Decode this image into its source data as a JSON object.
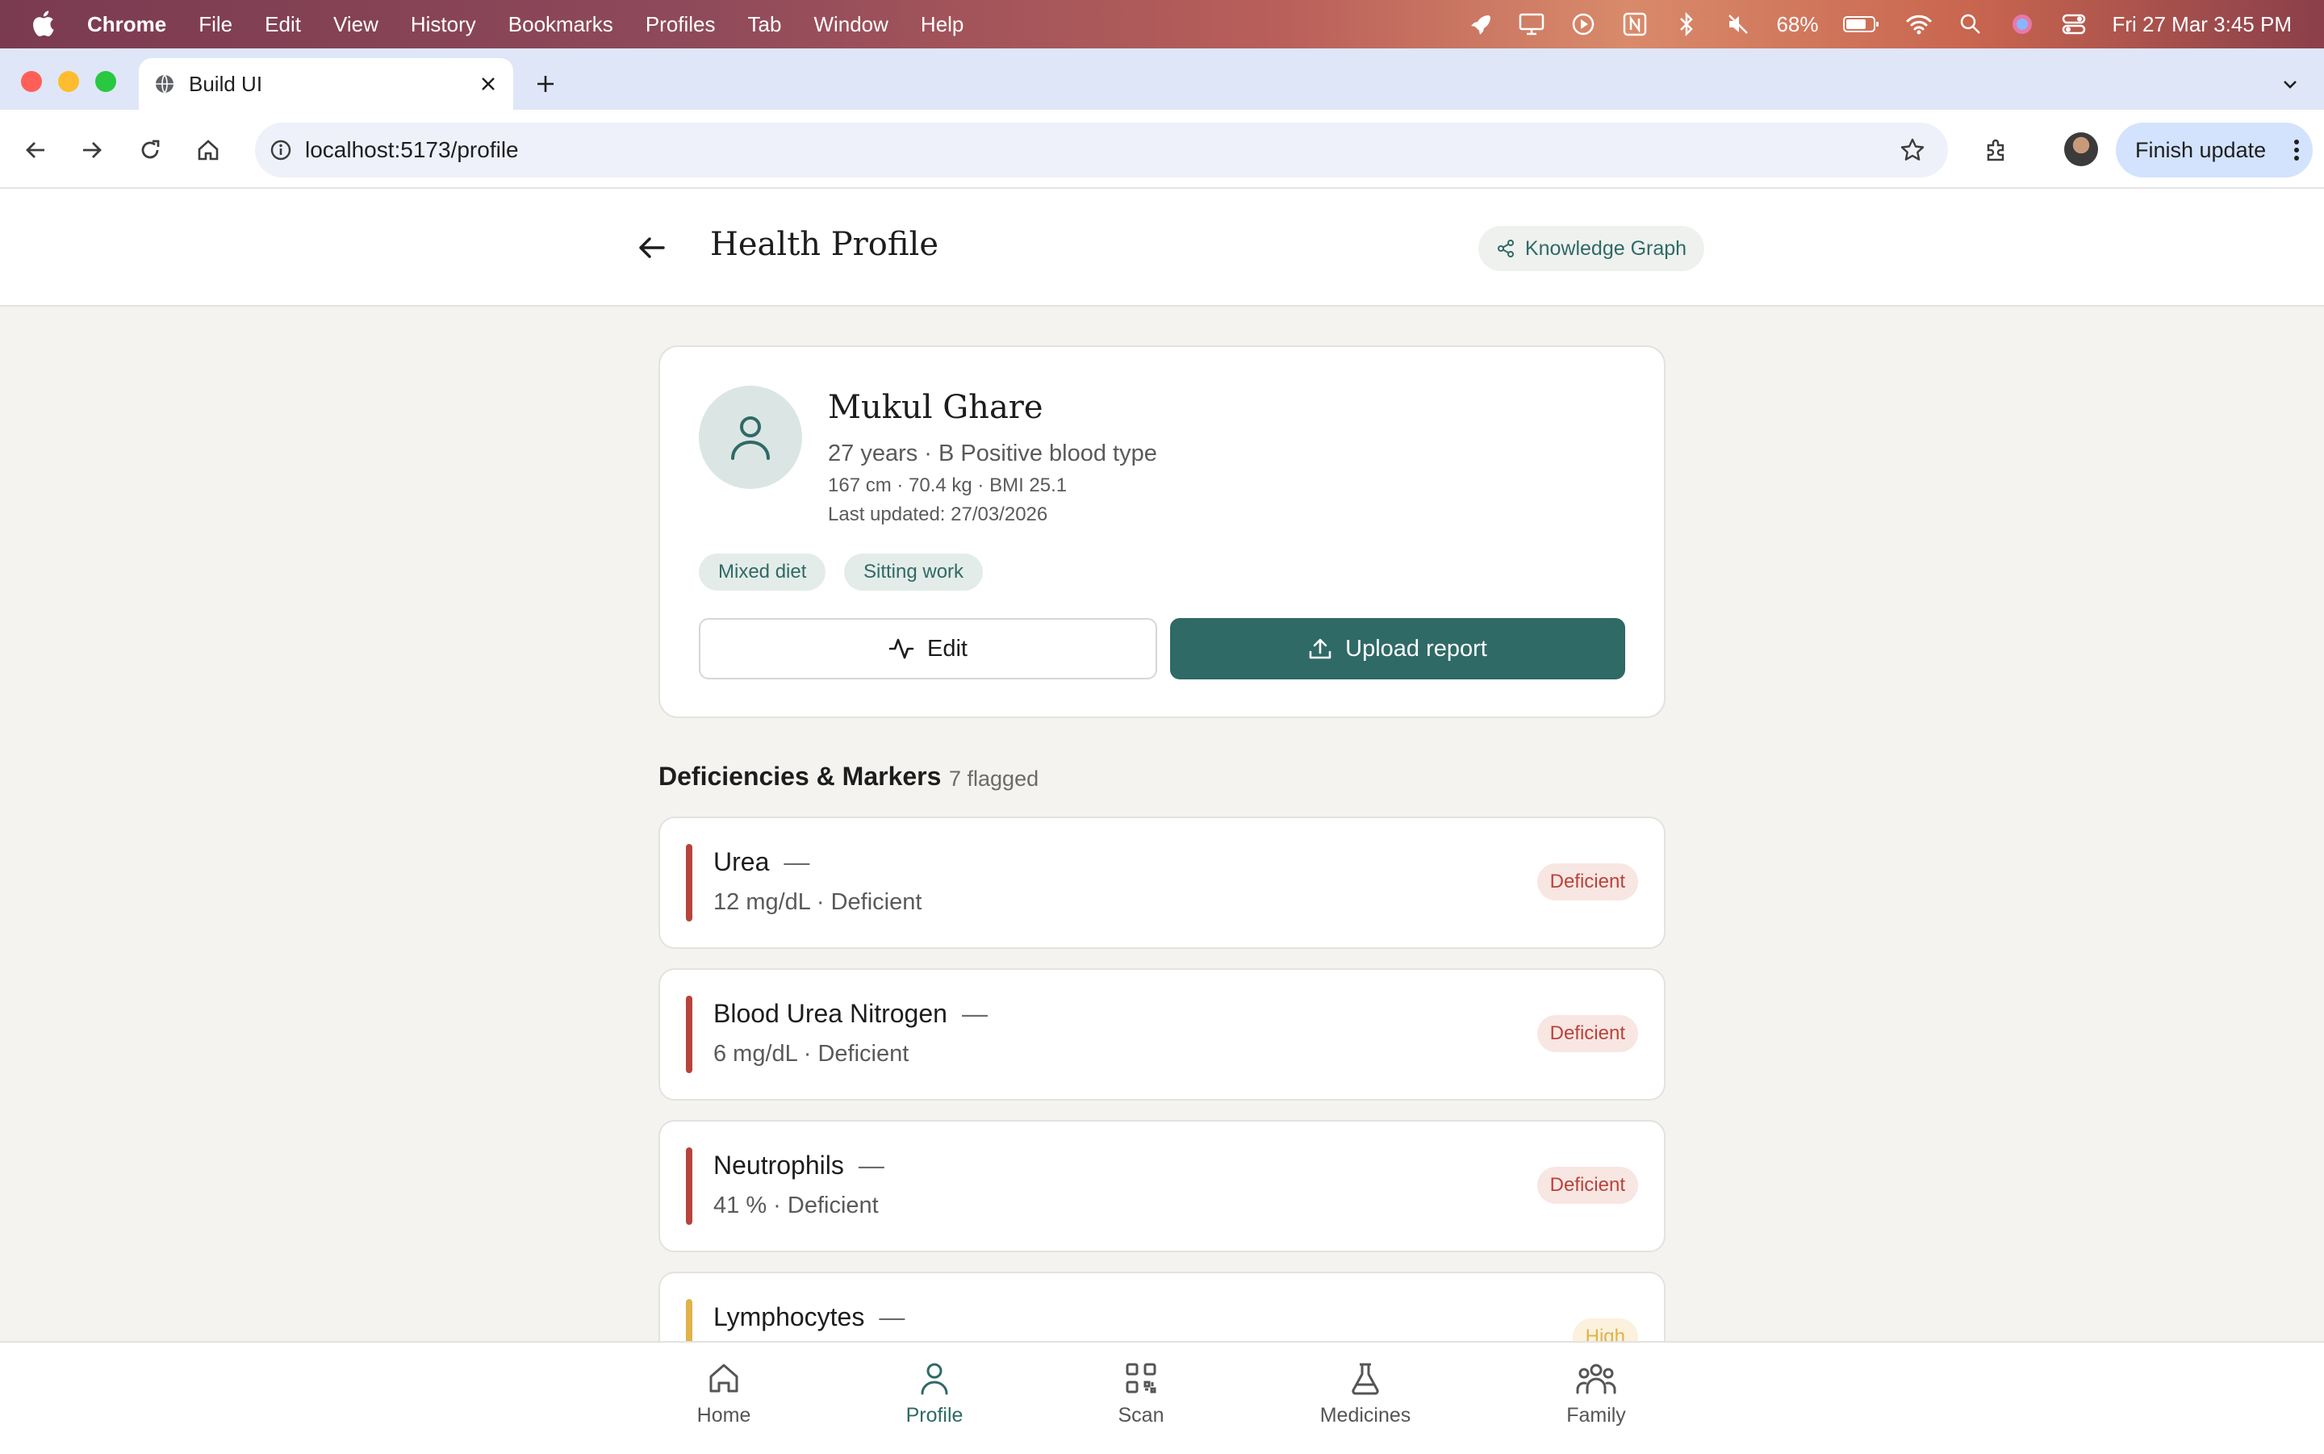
{
  "menubar": {
    "app": "Chrome",
    "items": [
      "File",
      "Edit",
      "View",
      "History",
      "Bookmarks",
      "Profiles",
      "Tab",
      "Window",
      "Help"
    ],
    "battery": "68%",
    "datetime": "Fri 27 Mar  3:45 PM"
  },
  "browser": {
    "tab_title": "Build UI",
    "url": "localhost:5173/profile",
    "finish_update": "Finish update"
  },
  "header": {
    "title": "Health Profile",
    "knowledge_graph": "Knowledge Graph"
  },
  "profile": {
    "name": "Mukul Ghare",
    "line1": "27 years · B Positive blood type",
    "line2": "167 cm · 70.4 kg · BMI 25.1",
    "line3": "Last updated: 27/03/2026",
    "tags": [
      "Mixed diet",
      "Sitting work"
    ],
    "edit_label": "Edit",
    "upload_label": "Upload report"
  },
  "section": {
    "title": "Deficiencies & Markers",
    "count": "7 flagged"
  },
  "markers": [
    {
      "name": "Urea",
      "trend": "—",
      "detail": "12 mg/dL · Deficient",
      "status": "Deficient"
    },
    {
      "name": "Blood Urea Nitrogen",
      "trend": "—",
      "detail": "6 mg/dL · Deficient",
      "status": "Deficient"
    },
    {
      "name": "Neutrophils",
      "trend": "—",
      "detail": "41 % · Deficient",
      "status": "Deficient"
    },
    {
      "name": "Lymphocytes",
      "trend": "—",
      "detail": "",
      "status": "High"
    }
  ],
  "bottom_nav": [
    {
      "label": "Home",
      "icon": "home-icon"
    },
    {
      "label": "Profile",
      "icon": "user-icon",
      "active": true
    },
    {
      "label": "Scan",
      "icon": "qr-scan-icon"
    },
    {
      "label": "Medicines",
      "icon": "flask-icon"
    },
    {
      "label": "Family",
      "icon": "family-icon"
    }
  ],
  "colors": {
    "accent": "#2f6a66",
    "deficient": "#b8433a",
    "deficient_bg": "#f8e6e3",
    "high": "#e0b24a",
    "high_bg": "#fbf1dc",
    "background": "#f4f3ef"
  }
}
